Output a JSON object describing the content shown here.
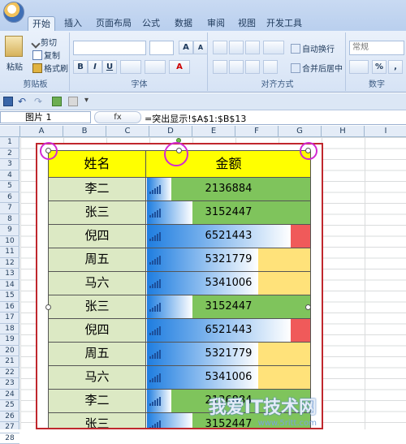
{
  "ribbon_tabs": [
    "开始",
    "插入",
    "页面布局",
    "公式",
    "数据",
    "审阅",
    "视图",
    "开发工具"
  ],
  "clipboard": {
    "paste": "粘贴",
    "cut": "剪切",
    "copy": "复制",
    "format_painter": "格式刷",
    "title": "剪贴板"
  },
  "font_group": {
    "title": "字体",
    "bold": "B",
    "italic": "I",
    "underline": "U",
    "grow": "A",
    "shrink": "A"
  },
  "alignment": {
    "title": "对齐方式",
    "wrap": "自动换行",
    "merge": "合并后居中"
  },
  "number": {
    "title": "数字",
    "format": "常规",
    "percent": "%"
  },
  "name_box": "图片 1",
  "fx_label": "fx",
  "formula": "=突出显示!$A$1:$B$13",
  "columns": [
    "A",
    "B",
    "C",
    "D",
    "E",
    "F",
    "G",
    "H",
    "I"
  ],
  "rows": [
    "1",
    "2",
    "3",
    "4",
    "5",
    "6",
    "7",
    "8",
    "9",
    "10",
    "11",
    "12",
    "13",
    "14",
    "15",
    "16",
    "17",
    "18",
    "19",
    "20",
    "21",
    "22",
    "23",
    "24",
    "25",
    "26",
    "27",
    "28"
  ],
  "table": {
    "header": {
      "name": "姓名",
      "amount": "金额"
    },
    "rows": [
      {
        "name": "李二",
        "amount": "2136884",
        "bar": 0.15,
        "color": "green"
      },
      {
        "name": "张三",
        "amount": "3152447",
        "bar": 0.28,
        "color": "green"
      },
      {
        "name": "倪四",
        "amount": "6521443",
        "bar": 0.88,
        "color": "red"
      },
      {
        "name": "周五",
        "amount": "5321779",
        "bar": 0.68,
        "color": "yellow"
      },
      {
        "name": "马六",
        "amount": "5341006",
        "bar": 0.68,
        "color": "yellow"
      },
      {
        "name": "张三",
        "amount": "3152447",
        "bar": 0.28,
        "color": "green"
      },
      {
        "name": "倪四",
        "amount": "6521443",
        "bar": 0.88,
        "color": "red"
      },
      {
        "name": "周五",
        "amount": "5321779",
        "bar": 0.68,
        "color": "yellow"
      },
      {
        "name": "马六",
        "amount": "5341006",
        "bar": 0.68,
        "color": "yellow"
      },
      {
        "name": "李二",
        "amount": "2136884",
        "bar": 0.15,
        "color": "green"
      },
      {
        "name": "张三",
        "amount": "3152447",
        "bar": 0.28,
        "color": "green"
      }
    ]
  },
  "colors": {
    "header": "#ffff00",
    "name_cell": "#dce9c4",
    "green": "#7fc45c",
    "yellow": "#ffe27a",
    "red": "#f05a5a",
    "bar": "#1e7de0"
  },
  "watermark": {
    "main": "我爱IT技术网",
    "sub": "www.5ritt.com"
  }
}
